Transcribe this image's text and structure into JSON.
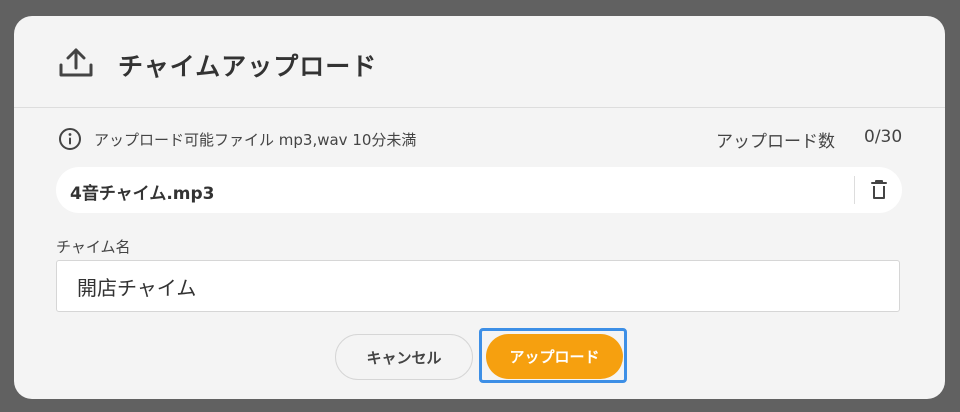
{
  "dialog": {
    "title": "チャイムアップロード",
    "title_icon": "upload-icon",
    "info": {
      "icon": "info-icon",
      "text": "アップロード可能ファイル mp3,wav 10分未満",
      "count_label": "アップロード数",
      "count_value": "0/30"
    },
    "file": {
      "name": "4音チャイム.mp3",
      "delete_icon": "trash-icon"
    },
    "chime_name": {
      "label": "チャイム名",
      "value": "開店チャイム"
    },
    "buttons": {
      "cancel": "キャンセル",
      "upload": "アップロード"
    }
  },
  "colors": {
    "backdrop": "#616161",
    "dialog_bg": "#f4f4f4",
    "accent": "#f6a00f",
    "focus": "#3d8fe6"
  }
}
